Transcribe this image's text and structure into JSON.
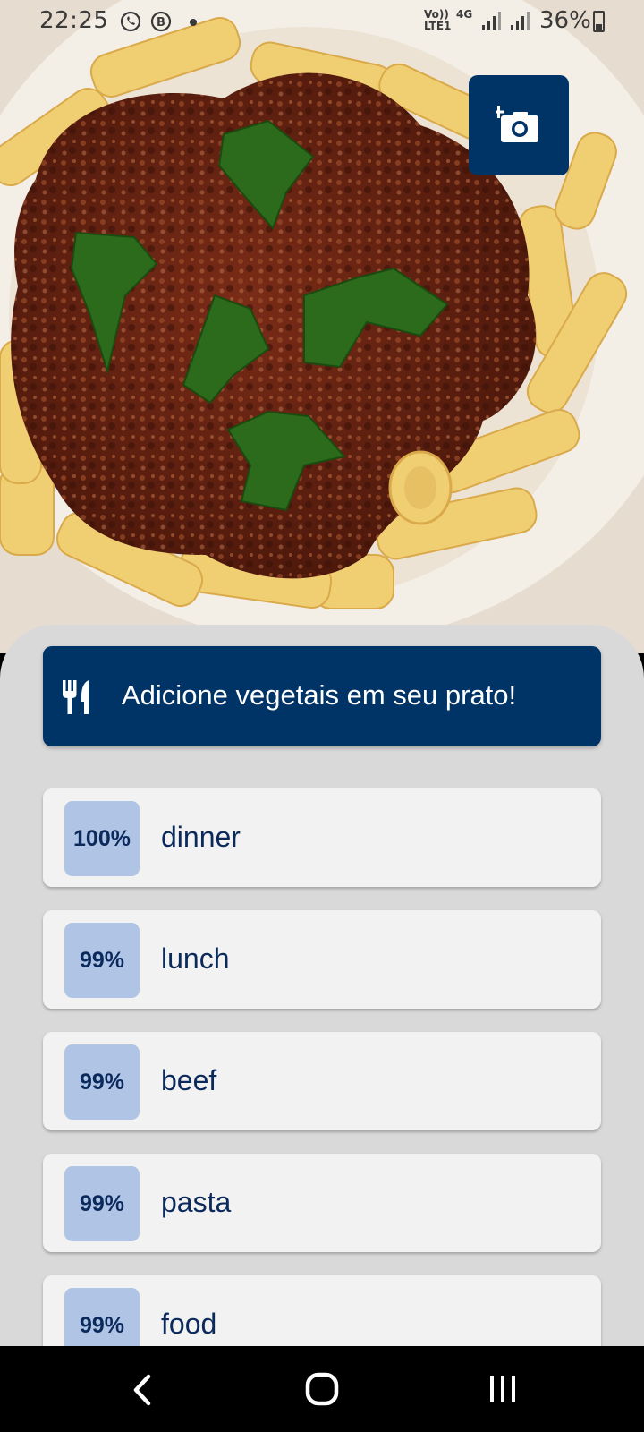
{
  "status_bar": {
    "time": "22:25",
    "left_icons": [
      "whatsapp-icon",
      "whatsapp-business-icon",
      "notification-dot"
    ],
    "volte_line1": "Vo))",
    "volte_line2": "LTE1",
    "network_type": "4G",
    "battery_percent": "36%"
  },
  "photo": {
    "description_icon": "pasta-photo",
    "add_photo_icon": "add-photo-camera-icon"
  },
  "banner": {
    "icon": "fork-knife-icon",
    "text": "Adicione vegetais em seu prato!"
  },
  "tags": [
    {
      "score": "100%",
      "label": "dinner"
    },
    {
      "score": "99%",
      "label": "lunch"
    },
    {
      "score": "99%",
      "label": "beef"
    },
    {
      "score": "99%",
      "label": "pasta"
    },
    {
      "score": "99%",
      "label": "food"
    }
  ],
  "nav": {
    "buttons": [
      "back-icon",
      "home-icon",
      "recents-icon"
    ]
  },
  "colors": {
    "primary": "#003366",
    "score_bg": "#b0c4e6",
    "card_bg": "#f2f2f2",
    "sheet_bg": "#d9d9d9"
  }
}
